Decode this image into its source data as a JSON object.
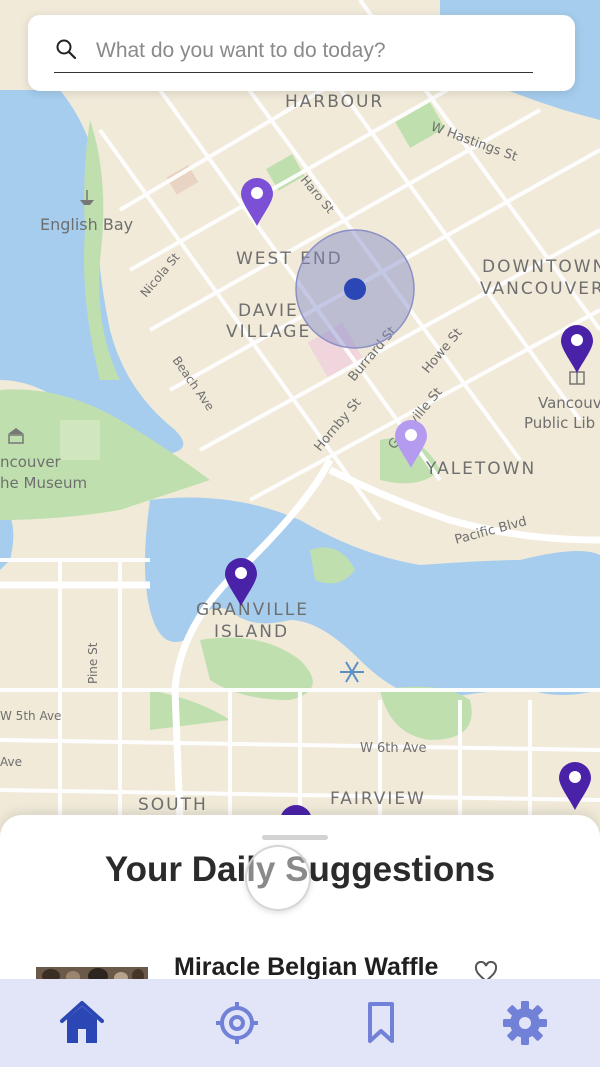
{
  "search": {
    "placeholder": "What do you want to do today?",
    "icon": "search-icon"
  },
  "map": {
    "labels": {
      "harbour": "HARBOUR",
      "west_end": "WEST END",
      "davie_1": "DAVIE",
      "davie_2": "VILLAGE",
      "downtown_1": "DOWNTOWN",
      "downtown_2": "VANCOUVER",
      "yaletown": "YALETOWN",
      "granville_1": "GRANVILLE",
      "granville_2": "ISLAND",
      "south": "SOUTH",
      "fairview": "FAIRVIEW",
      "english_bay": "English Bay",
      "library_1": "Vancouv",
      "library_2": "Public Lib",
      "museum_1": "ncouver",
      "museum_2": "he Museum"
    },
    "streets": {
      "w_hastings": "W Hastings St",
      "haro": "Haro St",
      "nicola": "Nicola St",
      "beach": "Beach Ave",
      "burrard": "Burrard St",
      "howe": "Howe St",
      "hornby": "Hornby St",
      "granville_st": "Granville St",
      "pacific": "Pacific Blvd",
      "pine": "Pine St",
      "w5": "W 5th Ave",
      "w6": "W 6th Ave",
      "ave": "Ave"
    },
    "pin_colors": {
      "dark": "#4a22a8",
      "mid": "#7b4fd6",
      "light": "#b49bf0"
    },
    "water_color": "#a6cdee",
    "park_color": "#bfe0ae",
    "user_location_color": "#2b47b5"
  },
  "sheet": {
    "title": "Your Daily Suggestions",
    "items": [
      {
        "title": "Miracle Belgian Waffle",
        "favorite_icon": "heart-icon"
      }
    ]
  },
  "nav": {
    "active_color": "#2b47b5",
    "inactive_color": "#7281d8",
    "items": [
      {
        "icon": "home-icon",
        "active": true
      },
      {
        "icon": "target-icon",
        "active": false
      },
      {
        "icon": "bookmark-icon",
        "active": false
      },
      {
        "icon": "gear-icon",
        "active": false
      }
    ]
  }
}
